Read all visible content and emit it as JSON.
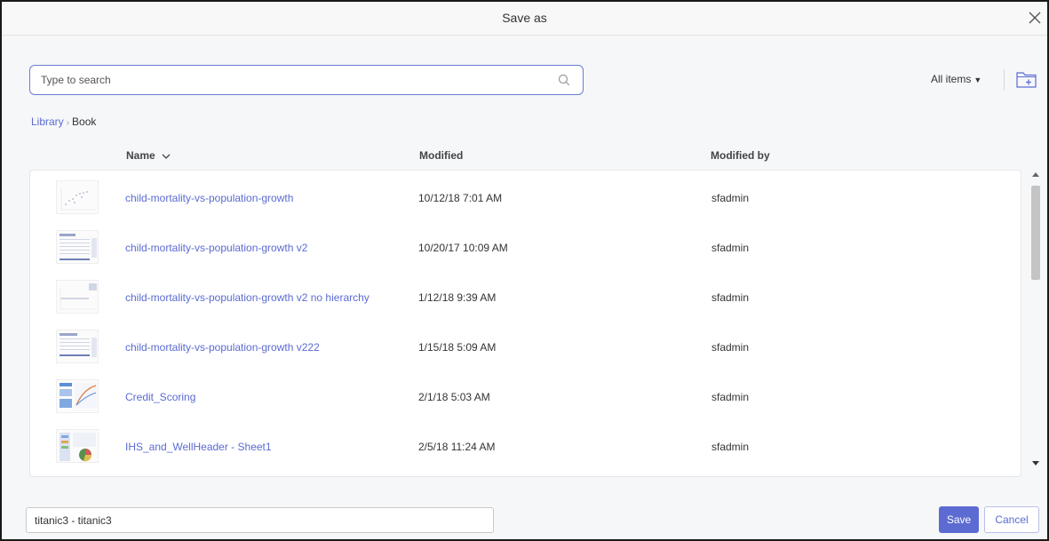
{
  "dialog": {
    "title": "Save as"
  },
  "search": {
    "placeholder": "Type to search",
    "value": ""
  },
  "filter": {
    "label": "All items"
  },
  "breadcrumb": {
    "root": "Library",
    "current": "Book"
  },
  "columns": {
    "name": "Name",
    "modified": "Modified",
    "modified_by": "Modified by"
  },
  "items": [
    {
      "name": "child-mortality-vs-population-growth",
      "modified": "10/12/18 7:01 AM",
      "modified_by": "sfadmin",
      "thumb": "scatter"
    },
    {
      "name": "child-mortality-vs-population-growth v2",
      "modified": "10/20/17 10:09 AM",
      "modified_by": "sfadmin",
      "thumb": "table"
    },
    {
      "name": "child-mortality-vs-population-growth v2 no hierarchy",
      "modified": "1/12/18 9:39 AM",
      "modified_by": "sfadmin",
      "thumb": "line"
    },
    {
      "name": "child-mortality-vs-population-growth v222",
      "modified": "1/15/18 5:09 AM",
      "modified_by": "sfadmin",
      "thumb": "table"
    },
    {
      "name": "Credit_Scoring",
      "modified": "2/1/18 5:03 AM",
      "modified_by": "sfadmin",
      "thumb": "dashboard"
    },
    {
      "name": "IHS_and_WellHeader - Sheet1",
      "modified": "2/5/18 11:24 AM",
      "modified_by": "sfadmin",
      "thumb": "map"
    }
  ],
  "filename": {
    "value": "titanic3 - titanic3"
  },
  "buttons": {
    "save": "Save",
    "cancel": "Cancel"
  },
  "colors": {
    "accent": "#5b6bd1",
    "border": "#1a1a1a"
  }
}
